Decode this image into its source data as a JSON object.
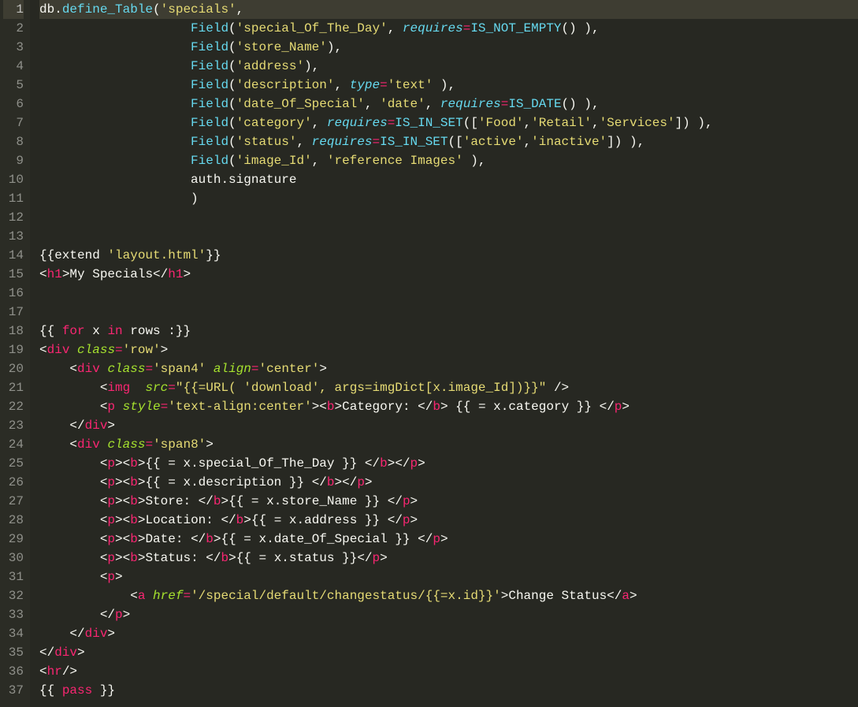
{
  "file": "editor",
  "active_line": 1,
  "lines": [
    {
      "n": 1,
      "tokens": [
        [
          "id",
          "db"
        ],
        [
          "pn",
          "."
        ],
        [
          "fn",
          "define_Table"
        ],
        [
          "pn",
          "("
        ],
        [
          "s",
          "'specials'"
        ],
        [
          "pn",
          ","
        ]
      ]
    },
    {
      "n": 2,
      "tokens": [
        [
          "pn",
          "                    "
        ],
        [
          "fn",
          "Field"
        ],
        [
          "pn",
          "("
        ],
        [
          "s",
          "'special_Of_The_Day'"
        ],
        [
          "pn",
          ", "
        ],
        [
          "kw2",
          "requires"
        ],
        [
          "k",
          "="
        ],
        [
          "fn",
          "IS_NOT_EMPTY"
        ],
        [
          "pn",
          "() ),"
        ]
      ]
    },
    {
      "n": 3,
      "tokens": [
        [
          "pn",
          "                    "
        ],
        [
          "fn",
          "Field"
        ],
        [
          "pn",
          "("
        ],
        [
          "s",
          "'store_Name'"
        ],
        [
          "pn",
          "),"
        ]
      ]
    },
    {
      "n": 4,
      "tokens": [
        [
          "pn",
          "                    "
        ],
        [
          "fn",
          "Field"
        ],
        [
          "pn",
          "("
        ],
        [
          "s",
          "'address'"
        ],
        [
          "pn",
          "),"
        ]
      ]
    },
    {
      "n": 5,
      "tokens": [
        [
          "pn",
          "                    "
        ],
        [
          "fn",
          "Field"
        ],
        [
          "pn",
          "("
        ],
        [
          "s",
          "'description'"
        ],
        [
          "pn",
          ", "
        ],
        [
          "kw2",
          "type"
        ],
        [
          "k",
          "="
        ],
        [
          "s",
          "'text'"
        ],
        [
          "pn",
          " ),"
        ]
      ]
    },
    {
      "n": 6,
      "tokens": [
        [
          "pn",
          "                    "
        ],
        [
          "fn",
          "Field"
        ],
        [
          "pn",
          "("
        ],
        [
          "s",
          "'date_Of_Special'"
        ],
        [
          "pn",
          ", "
        ],
        [
          "s",
          "'date'"
        ],
        [
          "pn",
          ", "
        ],
        [
          "kw2",
          "requires"
        ],
        [
          "k",
          "="
        ],
        [
          "fn",
          "IS_DATE"
        ],
        [
          "pn",
          "() ),"
        ]
      ]
    },
    {
      "n": 7,
      "tokens": [
        [
          "pn",
          "                    "
        ],
        [
          "fn",
          "Field"
        ],
        [
          "pn",
          "("
        ],
        [
          "s",
          "'category'"
        ],
        [
          "pn",
          ", "
        ],
        [
          "kw2",
          "requires"
        ],
        [
          "k",
          "="
        ],
        [
          "fn",
          "IS_IN_SET"
        ],
        [
          "pn",
          "(["
        ],
        [
          "s",
          "'Food'"
        ],
        [
          "pn",
          ","
        ],
        [
          "s",
          "'Retail'"
        ],
        [
          "pn",
          ","
        ],
        [
          "s",
          "'Services'"
        ],
        [
          "pn",
          "]) ),"
        ]
      ]
    },
    {
      "n": 8,
      "tokens": [
        [
          "pn",
          "                    "
        ],
        [
          "fn",
          "Field"
        ],
        [
          "pn",
          "("
        ],
        [
          "s",
          "'status'"
        ],
        [
          "pn",
          ", "
        ],
        [
          "kw2",
          "requires"
        ],
        [
          "k",
          "="
        ],
        [
          "fn",
          "IS_IN_SET"
        ],
        [
          "pn",
          "(["
        ],
        [
          "s",
          "'active'"
        ],
        [
          "pn",
          ","
        ],
        [
          "s",
          "'inactive'"
        ],
        [
          "pn",
          "]) ),"
        ]
      ]
    },
    {
      "n": 9,
      "tokens": [
        [
          "pn",
          "                    "
        ],
        [
          "fn",
          "Field"
        ],
        [
          "pn",
          "("
        ],
        [
          "s",
          "'image_Id'"
        ],
        [
          "pn",
          ", "
        ],
        [
          "s",
          "'reference Images'"
        ],
        [
          "pn",
          " ),"
        ]
      ]
    },
    {
      "n": 10,
      "tokens": [
        [
          "pn",
          "                    "
        ],
        [
          "id",
          "auth"
        ],
        [
          "pn",
          "."
        ],
        [
          "id",
          "signature"
        ]
      ]
    },
    {
      "n": 11,
      "tokens": [
        [
          "pn",
          "                    )"
        ]
      ]
    },
    {
      "n": 12,
      "tokens": []
    },
    {
      "n": 13,
      "tokens": []
    },
    {
      "n": 14,
      "tokens": [
        [
          "pn",
          "{{"
        ],
        [
          "id",
          "extend "
        ],
        [
          "s",
          "'layout.html'"
        ],
        [
          "pn",
          "}}"
        ]
      ]
    },
    {
      "n": 15,
      "tokens": [
        [
          "pn",
          "<"
        ],
        [
          "k",
          "h1"
        ],
        [
          "pn",
          ">"
        ],
        [
          "id",
          "My Specials"
        ],
        [
          "pn",
          "</"
        ],
        [
          "k",
          "h1"
        ],
        [
          "pn",
          ">"
        ]
      ]
    },
    {
      "n": 16,
      "tokens": []
    },
    {
      "n": 17,
      "tokens": []
    },
    {
      "n": 18,
      "tokens": [
        [
          "pn",
          "{{ "
        ],
        [
          "k",
          "for"
        ],
        [
          "id",
          " x "
        ],
        [
          "k",
          "in"
        ],
        [
          "id",
          " rows "
        ],
        [
          "pn",
          ":}}"
        ]
      ]
    },
    {
      "n": 19,
      "tokens": [
        [
          "pn",
          "<"
        ],
        [
          "k",
          "div"
        ],
        [
          "pn",
          " "
        ],
        [
          "attr",
          "class"
        ],
        [
          "k",
          "="
        ],
        [
          "s",
          "'row'"
        ],
        [
          "pn",
          ">"
        ]
      ]
    },
    {
      "n": 20,
      "tokens": [
        [
          "pn",
          "    <"
        ],
        [
          "k",
          "div"
        ],
        [
          "pn",
          " "
        ],
        [
          "attr",
          "class"
        ],
        [
          "k",
          "="
        ],
        [
          "s",
          "'span4'"
        ],
        [
          "pn",
          " "
        ],
        [
          "attr",
          "align"
        ],
        [
          "k",
          "="
        ],
        [
          "s",
          "'center'"
        ],
        [
          "pn",
          ">"
        ]
      ]
    },
    {
      "n": 21,
      "tokens": [
        [
          "pn",
          "        <"
        ],
        [
          "k",
          "img"
        ],
        [
          "pn",
          "  "
        ],
        [
          "attr",
          "src"
        ],
        [
          "k",
          "="
        ],
        [
          "s",
          "\"{{=URL( 'download', args=imgDict[x.image_Id])}}\""
        ],
        [
          "pn",
          " />"
        ]
      ]
    },
    {
      "n": 22,
      "tokens": [
        [
          "pn",
          "        <"
        ],
        [
          "k",
          "p"
        ],
        [
          "pn",
          " "
        ],
        [
          "attr",
          "style"
        ],
        [
          "k",
          "="
        ],
        [
          "s",
          "'text-align:center'"
        ],
        [
          "pn",
          "><"
        ],
        [
          "k",
          "b"
        ],
        [
          "pn",
          ">"
        ],
        [
          "id",
          "Category: "
        ],
        [
          "pn",
          "</"
        ],
        [
          "k",
          "b"
        ],
        [
          "pn",
          "> "
        ],
        [
          "id",
          "{{ = x.category }} "
        ],
        [
          "pn",
          "</"
        ],
        [
          "k",
          "p"
        ],
        [
          "pn",
          ">"
        ]
      ]
    },
    {
      "n": 23,
      "tokens": [
        [
          "pn",
          "    </"
        ],
        [
          "k",
          "div"
        ],
        [
          "pn",
          ">"
        ]
      ]
    },
    {
      "n": 24,
      "tokens": [
        [
          "pn",
          "    <"
        ],
        [
          "k",
          "div"
        ],
        [
          "pn",
          " "
        ],
        [
          "attr",
          "class"
        ],
        [
          "k",
          "="
        ],
        [
          "s",
          "'span8'"
        ],
        [
          "pn",
          ">"
        ]
      ]
    },
    {
      "n": 25,
      "tokens": [
        [
          "pn",
          "        <"
        ],
        [
          "k",
          "p"
        ],
        [
          "pn",
          "><"
        ],
        [
          "k",
          "b"
        ],
        [
          "pn",
          ">"
        ],
        [
          "id",
          "{{ = x.special_Of_The_Day }} "
        ],
        [
          "pn",
          "</"
        ],
        [
          "k",
          "b"
        ],
        [
          "pn",
          "></"
        ],
        [
          "k",
          "p"
        ],
        [
          "pn",
          ">"
        ]
      ]
    },
    {
      "n": 26,
      "tokens": [
        [
          "pn",
          "        <"
        ],
        [
          "k",
          "p"
        ],
        [
          "pn",
          "><"
        ],
        [
          "k",
          "b"
        ],
        [
          "pn",
          ">"
        ],
        [
          "id",
          "{{ = x.description }} "
        ],
        [
          "pn",
          "</"
        ],
        [
          "k",
          "b"
        ],
        [
          "pn",
          "></"
        ],
        [
          "k",
          "p"
        ],
        [
          "pn",
          ">"
        ]
      ]
    },
    {
      "n": 27,
      "tokens": [
        [
          "pn",
          "        <"
        ],
        [
          "k",
          "p"
        ],
        [
          "pn",
          "><"
        ],
        [
          "k",
          "b"
        ],
        [
          "pn",
          ">"
        ],
        [
          "id",
          "Store: "
        ],
        [
          "pn",
          "</"
        ],
        [
          "k",
          "b"
        ],
        [
          "pn",
          ">"
        ],
        [
          "id",
          "{{ = x.store_Name }} "
        ],
        [
          "pn",
          "</"
        ],
        [
          "k",
          "p"
        ],
        [
          "pn",
          ">"
        ]
      ]
    },
    {
      "n": 28,
      "tokens": [
        [
          "pn",
          "        <"
        ],
        [
          "k",
          "p"
        ],
        [
          "pn",
          "><"
        ],
        [
          "k",
          "b"
        ],
        [
          "pn",
          ">"
        ],
        [
          "id",
          "Location: "
        ],
        [
          "pn",
          "</"
        ],
        [
          "k",
          "b"
        ],
        [
          "pn",
          ">"
        ],
        [
          "id",
          "{{ = x.address }} "
        ],
        [
          "pn",
          "</"
        ],
        [
          "k",
          "p"
        ],
        [
          "pn",
          ">"
        ]
      ]
    },
    {
      "n": 29,
      "tokens": [
        [
          "pn",
          "        <"
        ],
        [
          "k",
          "p"
        ],
        [
          "pn",
          "><"
        ],
        [
          "k",
          "b"
        ],
        [
          "pn",
          ">"
        ],
        [
          "id",
          "Date: "
        ],
        [
          "pn",
          "</"
        ],
        [
          "k",
          "b"
        ],
        [
          "pn",
          ">"
        ],
        [
          "id",
          "{{ = x.date_Of_Special }} "
        ],
        [
          "pn",
          "</"
        ],
        [
          "k",
          "p"
        ],
        [
          "pn",
          ">"
        ]
      ]
    },
    {
      "n": 30,
      "tokens": [
        [
          "pn",
          "        <"
        ],
        [
          "k",
          "p"
        ],
        [
          "pn",
          "><"
        ],
        [
          "k",
          "b"
        ],
        [
          "pn",
          ">"
        ],
        [
          "id",
          "Status: "
        ],
        [
          "pn",
          "</"
        ],
        [
          "k",
          "b"
        ],
        [
          "pn",
          ">"
        ],
        [
          "id",
          "{{ = x.status }}"
        ],
        [
          "pn",
          "</"
        ],
        [
          "k",
          "p"
        ],
        [
          "pn",
          ">"
        ]
      ]
    },
    {
      "n": 31,
      "tokens": [
        [
          "pn",
          "        <"
        ],
        [
          "k",
          "p"
        ],
        [
          "pn",
          ">"
        ]
      ]
    },
    {
      "n": 32,
      "tokens": [
        [
          "pn",
          "            <"
        ],
        [
          "k",
          "a"
        ],
        [
          "pn",
          " "
        ],
        [
          "attr",
          "href"
        ],
        [
          "k",
          "="
        ],
        [
          "s",
          "'/special/default/changestatus/{{=x.id}}'"
        ],
        [
          "pn",
          ">"
        ],
        [
          "id",
          "Change Status"
        ],
        [
          "pn",
          "</"
        ],
        [
          "k",
          "a"
        ],
        [
          "pn",
          ">"
        ]
      ]
    },
    {
      "n": 33,
      "tokens": [
        [
          "pn",
          "        </"
        ],
        [
          "k",
          "p"
        ],
        [
          "pn",
          ">"
        ]
      ]
    },
    {
      "n": 34,
      "tokens": [
        [
          "pn",
          "    </"
        ],
        [
          "k",
          "div"
        ],
        [
          "pn",
          ">"
        ]
      ]
    },
    {
      "n": 35,
      "tokens": [
        [
          "pn",
          "</"
        ],
        [
          "k",
          "div"
        ],
        [
          "pn",
          ">"
        ]
      ]
    },
    {
      "n": 36,
      "tokens": [
        [
          "pn",
          "<"
        ],
        [
          "k",
          "hr"
        ],
        [
          "pn",
          "/>"
        ]
      ]
    },
    {
      "n": 37,
      "tokens": [
        [
          "pn",
          "{{ "
        ],
        [
          "k",
          "pass"
        ],
        [
          "pn",
          " }}"
        ]
      ]
    }
  ]
}
